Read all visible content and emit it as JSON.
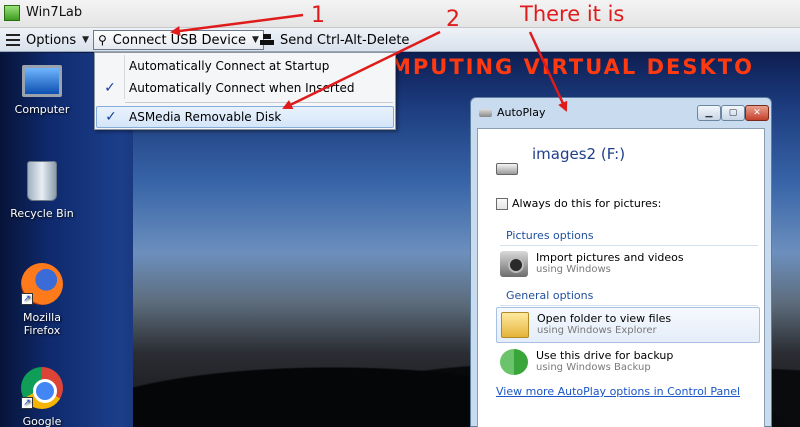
{
  "window": {
    "title": "Win7Lab"
  },
  "toolbar": {
    "options_label": "Options",
    "usb_label": "Connect USB Device",
    "cad_label": "Send Ctrl-Alt-Delete"
  },
  "usb_menu": {
    "items": [
      {
        "label": "Automatically Connect at Startup",
        "checked": false
      },
      {
        "label": "Automatically Connect when Inserted",
        "checked": true
      },
      {
        "label": "ASMedia Removable Disk",
        "checked": true
      }
    ],
    "check_glyph": "✓"
  },
  "desktop": {
    "banner": "MPUTING VIRTUAL DESKTO",
    "icons": [
      {
        "label": "Computer",
        "icon": "computer-icon"
      },
      {
        "label": "Recycle Bin",
        "icon": "recycle-bin-icon"
      },
      {
        "label": "Mozilla Firefox",
        "icon": "firefox-icon"
      },
      {
        "label": "Google",
        "icon": "chrome-icon"
      }
    ]
  },
  "autoplay": {
    "title": "AutoPlay",
    "drive": "images2 (F:)",
    "always_label": "Always do this for pictures:",
    "always_checked": false,
    "pictures_section": "Pictures options",
    "import_title": "Import pictures and videos",
    "import_sub": "using Windows",
    "general_section": "General options",
    "open_title": "Open folder to view files",
    "open_sub": "using Windows Explorer",
    "backup_title": "Use this drive for backup",
    "backup_sub": "using Windows Backup",
    "link": "View more AutoPlay options in Control Panel"
  },
  "annotations": {
    "one": "1",
    "two": "2",
    "there": "There it is"
  },
  "colors": {
    "annotation": "#e01b1b",
    "link": "#1a56c8",
    "section": "#1f4f9c"
  }
}
